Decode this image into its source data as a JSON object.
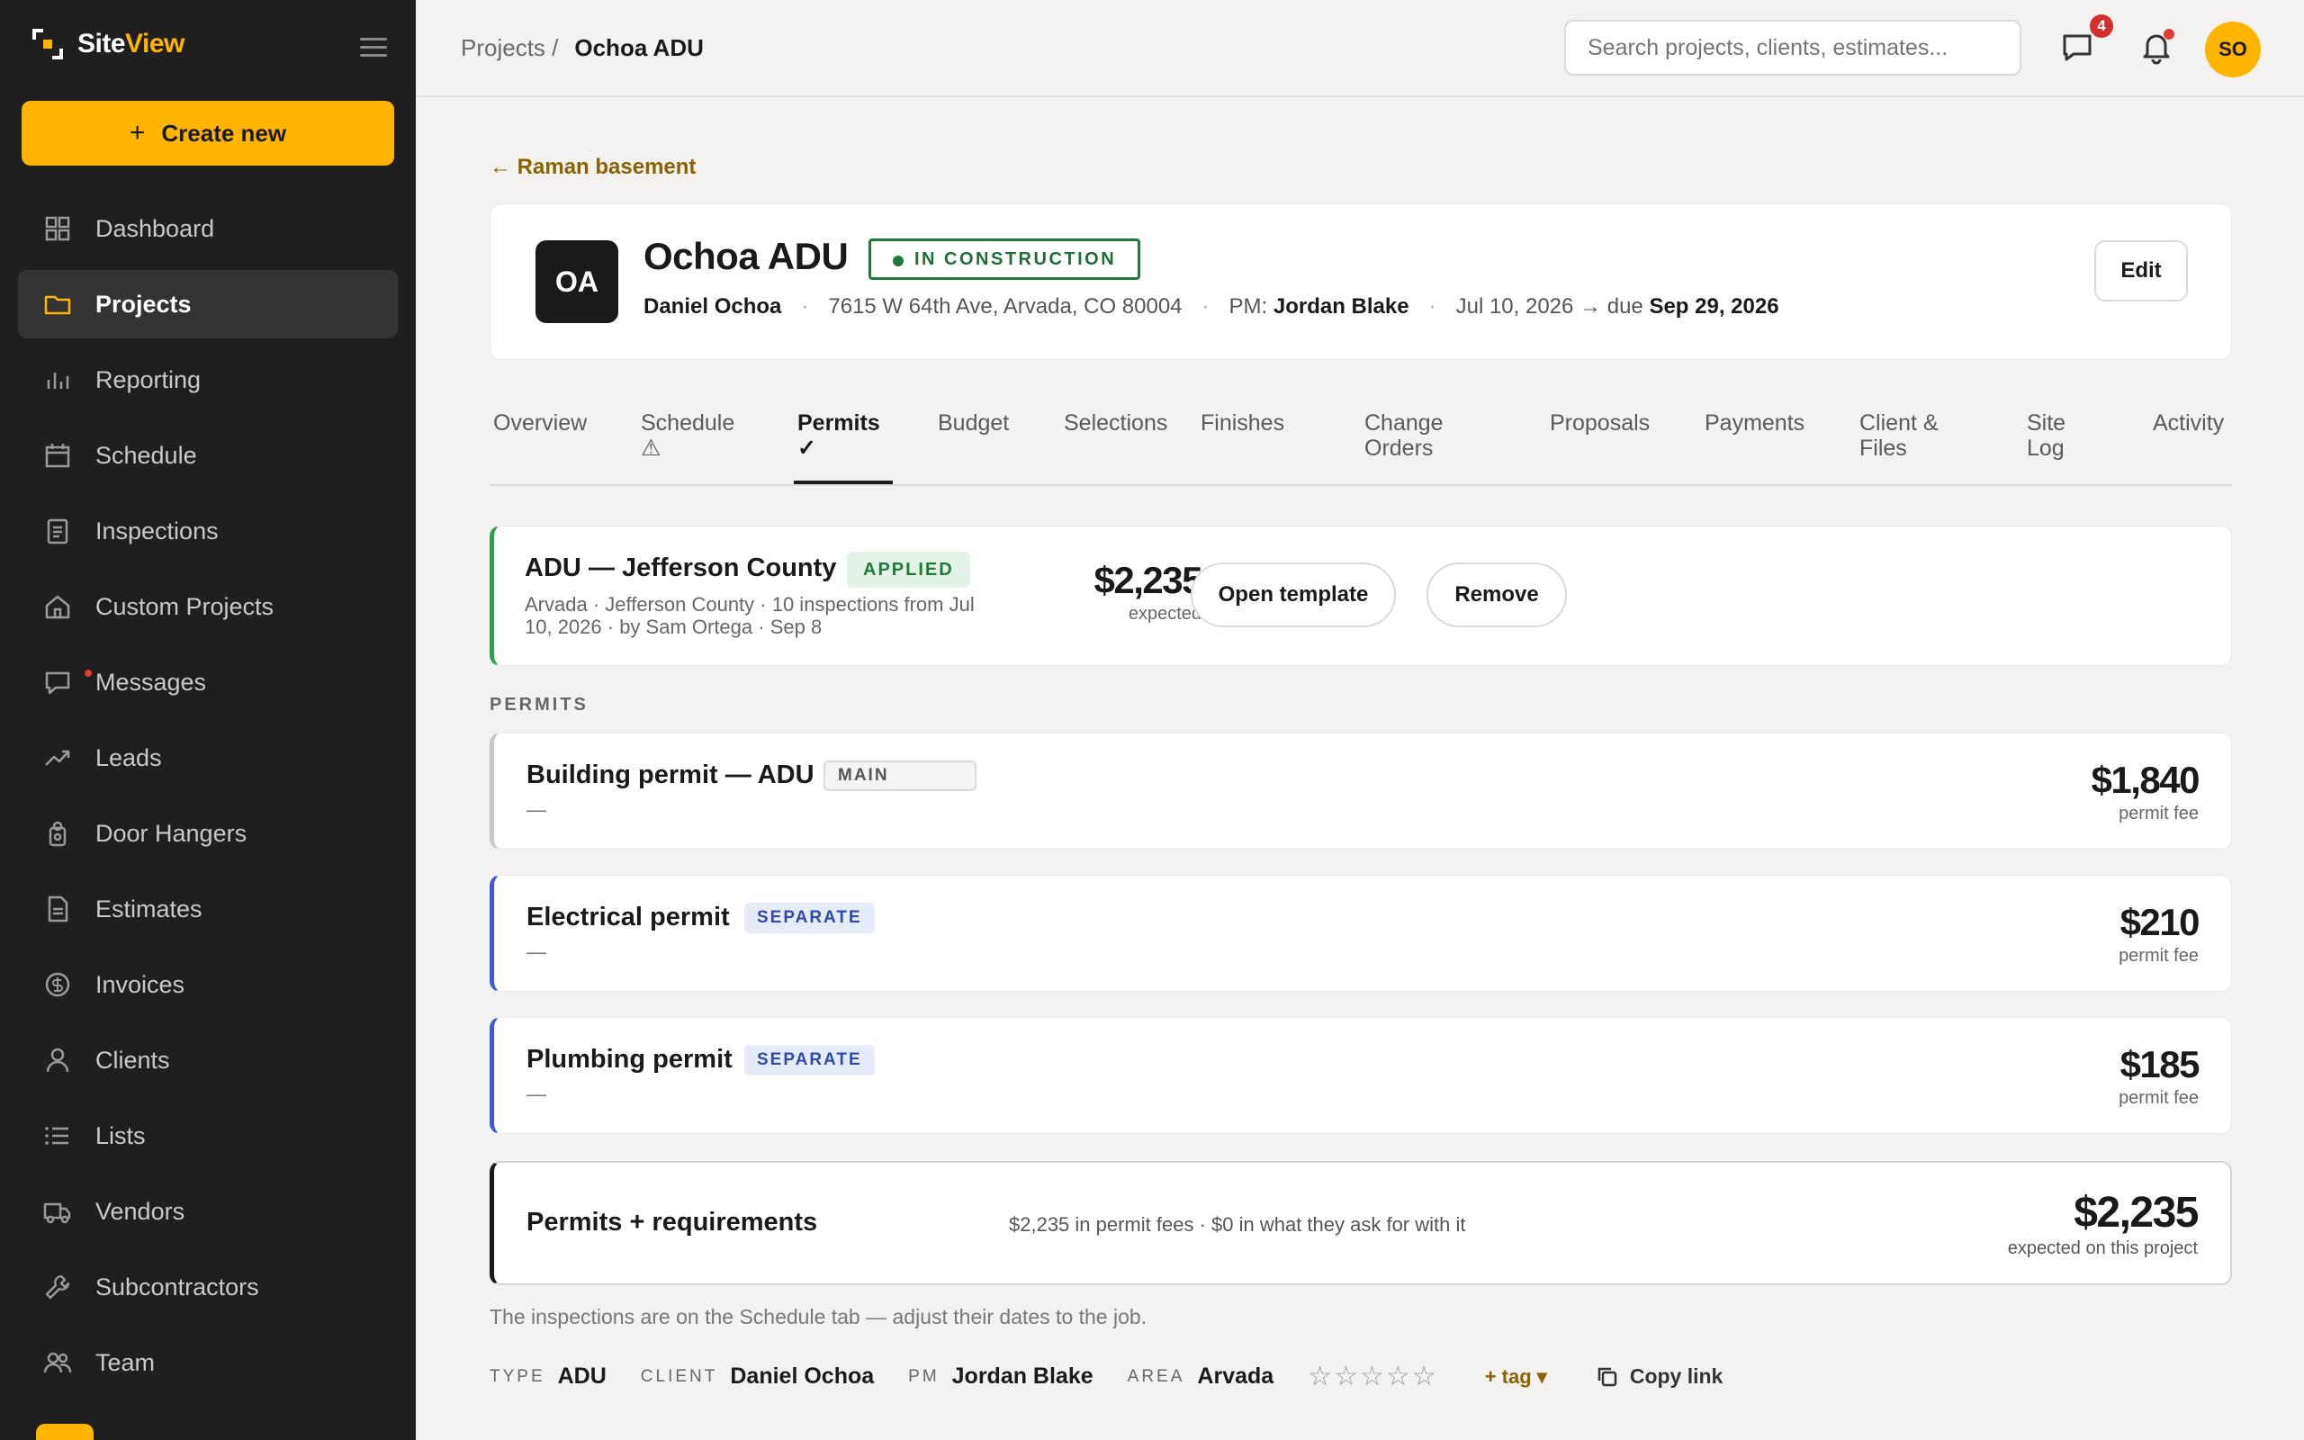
{
  "app": {
    "name_prefix": "Site",
    "name_accent": "View",
    "create_label": "Create new",
    "create_plus": "+"
  },
  "nav": [
    {
      "label": "Dashboard",
      "icon": "grid-icon"
    },
    {
      "label": "Projects",
      "icon": "folder-icon",
      "active": true
    },
    {
      "label": "Reporting",
      "icon": "bar-chart-icon"
    },
    {
      "label": "Schedule",
      "icon": "calendar-icon"
    },
    {
      "label": "Inspections",
      "icon": "clipboard-icon"
    },
    {
      "label": "Custom Projects",
      "icon": "home-icon"
    },
    {
      "label": "Messages",
      "icon": "message-icon",
      "dot": true
    },
    {
      "label": "Leads",
      "icon": "trending-up-icon"
    },
    {
      "label": "Door Hangers",
      "icon": "door-hanger-icon"
    },
    {
      "label": "Estimates",
      "icon": "document-icon"
    },
    {
      "label": "Invoices",
      "icon": "dollar-circle-icon"
    },
    {
      "label": "Clients",
      "icon": "user-icon"
    },
    {
      "label": "Lists",
      "icon": "list-icon"
    },
    {
      "label": "Vendors",
      "icon": "truck-icon"
    },
    {
      "label": "Subcontractors",
      "icon": "wrench-icon"
    },
    {
      "label": "Team",
      "icon": "users-icon"
    }
  ],
  "header": {
    "crumb_parent": "Projects /",
    "crumb_current": "Ochoa ADU",
    "search_placeholder": "Search projects, clients, estimates...",
    "messages_badge": "4",
    "avatar_initials": "SO"
  },
  "project": {
    "back_link": "← Raman basement",
    "initials": "OA",
    "title": "Ochoa ADU",
    "status": "IN CONSTRUCTION",
    "client": "Daniel Ochoa",
    "address": "7615 W 64th Ave, Arvada, CO 80004",
    "pm_label": "PM:",
    "pm": "Jordan Blake",
    "dates_prefix": "Jul 10, 2026 → due",
    "due": "Sep 29, 2026",
    "edit_label": "Edit",
    "meta_sep": "·"
  },
  "tabs": [
    {
      "line1": "Overview",
      "line2": ""
    },
    {
      "line1": "Schedule",
      "line2": "⚠"
    },
    {
      "line1": "Permits",
      "line2": "✓",
      "active": true
    },
    {
      "line1": "Budget",
      "line2": ""
    },
    {
      "line1": "Selections",
      "line2": ""
    },
    {
      "line1": "Finishes",
      "line2": ""
    },
    {
      "line1": "Change",
      "line2": "Orders"
    },
    {
      "line1": "Proposals",
      "line2": ""
    },
    {
      "line1": "Payments",
      "line2": ""
    },
    {
      "line1": "Client &",
      "line2": "Files"
    },
    {
      "line1": "Site",
      "line2": "Log"
    },
    {
      "line1": "Activity",
      "line2": ""
    }
  ],
  "template": {
    "title": "ADU — Jefferson County",
    "status": "APPLIED",
    "sub": "Arvada · Jefferson County · 10 inspections from Jul 10, 2026 · by Sam Ortega · Sep 8",
    "amount": "$2,235",
    "amount_sub": "expected",
    "open_label": "Open template",
    "remove_label": "Remove"
  },
  "permits_label": "PERMITS",
  "permits": [
    {
      "title": "Building permit — ADU",
      "tag": "MAIN",
      "kind": "main",
      "detail": "—",
      "amount": "$1,840",
      "amount_sub": "permit fee"
    },
    {
      "title": "Electrical permit",
      "tag": "SEPARATE",
      "kind": "separate",
      "detail": "—",
      "amount": "$210",
      "amount_sub": "permit fee"
    },
    {
      "title": "Plumbing permit",
      "tag": "SEPARATE",
      "kind": "separate",
      "detail": "—",
      "amount": "$185",
      "amount_sub": "permit fee"
    }
  ],
  "total": {
    "title": "Permits + requirements",
    "mid": "$2,235 in permit fees · $0 in what they ask for with it",
    "amount": "$2,235",
    "amount_sub": "expected on this project"
  },
  "note": "The inspections are on the Schedule tab — adjust their dates to the job.",
  "footer": {
    "type_label": "TYPE",
    "type": "ADU",
    "client_label": "CLIENT",
    "client": "Daniel Ochoa",
    "pm_label": "PM",
    "pm": "Jordan Blake",
    "area_label": "AREA",
    "area": "Arvada",
    "rating": 0,
    "rating_max": 5,
    "tag_label": "+ tag ▾",
    "copy_label": "Copy link"
  },
  "colors": {
    "accent": "#ffb400",
    "sidebar_bg": "#1f1f1f",
    "status_green": "#1f7a3a",
    "separate_blue": "#3f5bd4"
  }
}
